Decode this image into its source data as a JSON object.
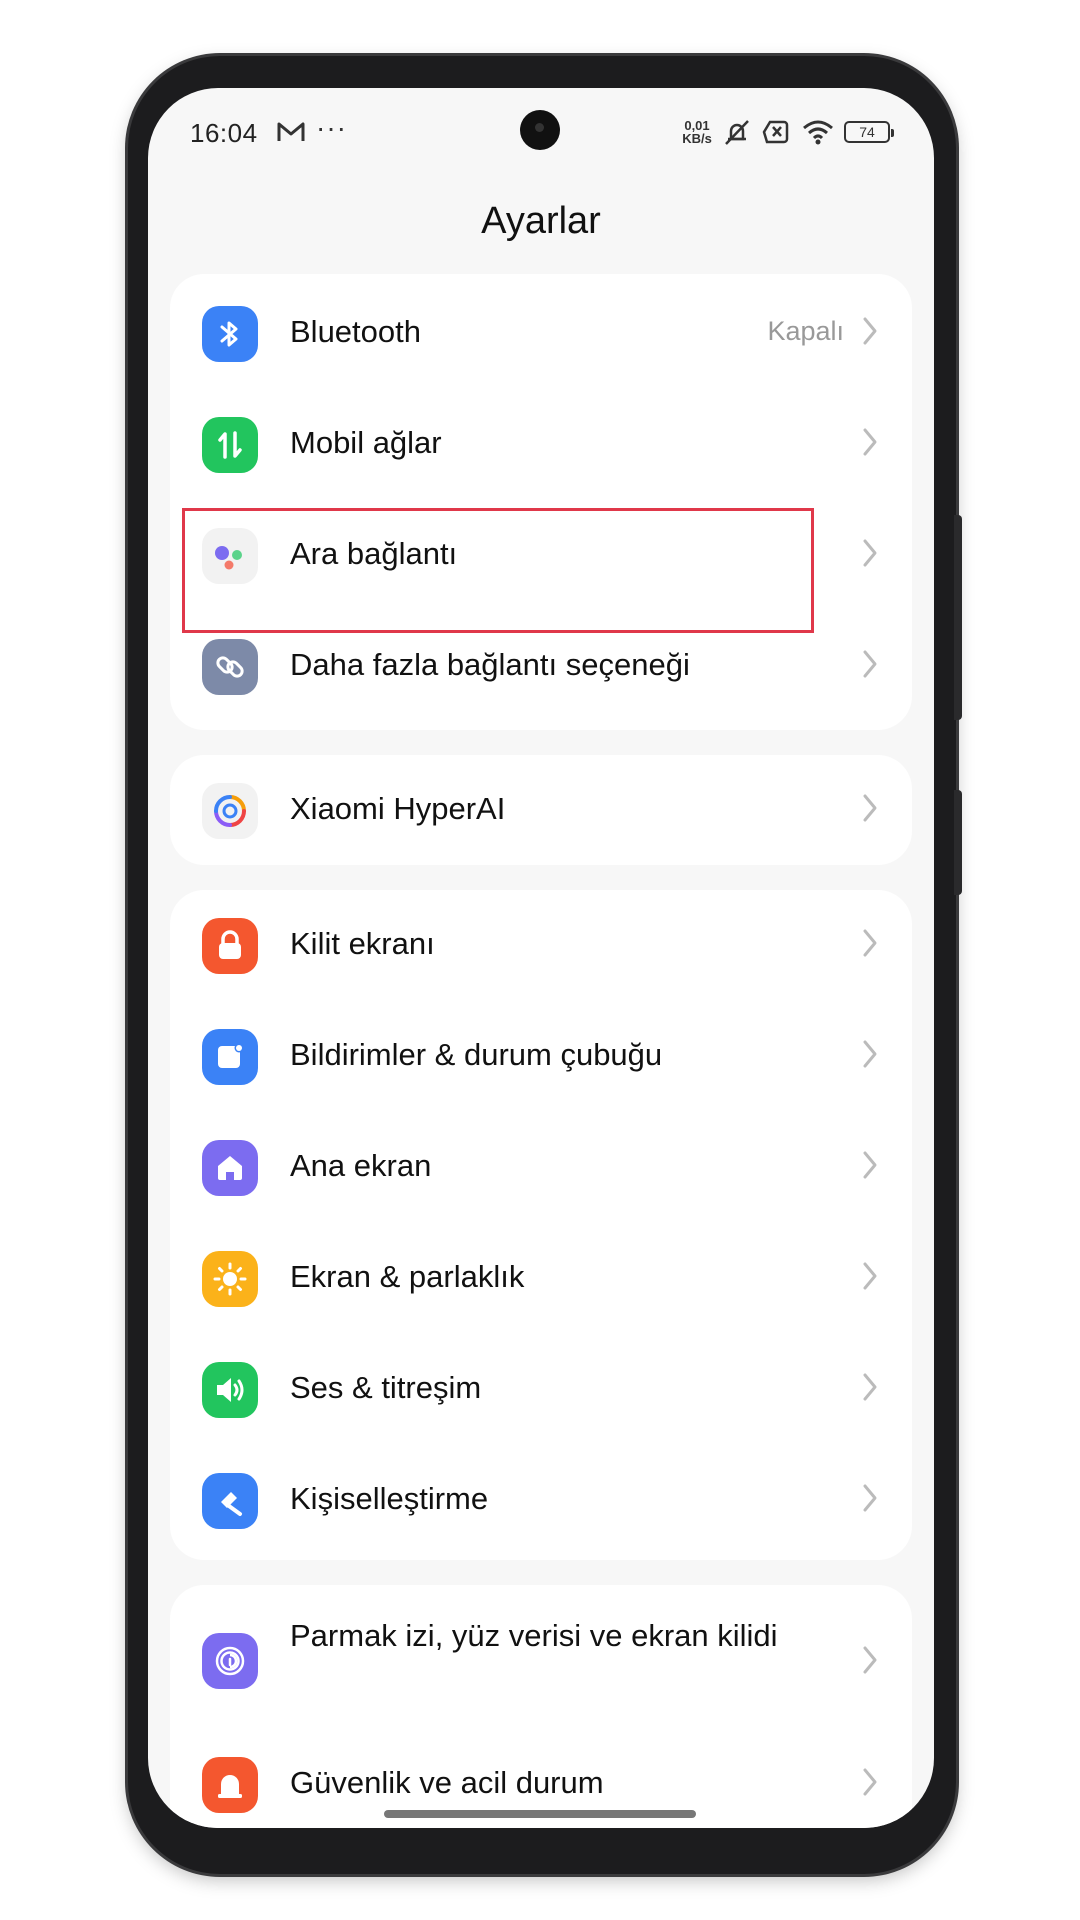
{
  "status": {
    "time": "16:04",
    "dots": "···",
    "speed_value": "0,01",
    "speed_unit": "KB/s",
    "battery": "74"
  },
  "header": {
    "title": "Ayarlar"
  },
  "groups": [
    {
      "items": [
        {
          "label": "Bluetooth",
          "value": "Kapalı",
          "icon": "bluetooth-icon",
          "color": "#3b82f6"
        },
        {
          "label": "Mobil ağlar",
          "icon": "mobile-data-icon",
          "color": "#22c55e"
        },
        {
          "label": "Ara bağlantı",
          "icon": "interconnect-icon",
          "color": "#f2f2f2"
        },
        {
          "label": "Daha fazla bağlantı seçeneği",
          "icon": "link-icon",
          "color": "#7d8aa8"
        }
      ]
    },
    {
      "items": [
        {
          "label": "Xiaomi HyperAI",
          "icon": "hyperai-icon",
          "color": "#f2f2f2"
        }
      ]
    },
    {
      "items": [
        {
          "label": "Kilit ekranı",
          "icon": "lock-icon",
          "color": "#f4572f"
        },
        {
          "label": "Bildirimler & durum çubuğu",
          "icon": "notification-icon",
          "color": "#3b82f6"
        },
        {
          "label": "Ana ekran",
          "icon": "home-icon",
          "color": "#7c6cf0"
        },
        {
          "label": "Ekran & parlaklık",
          "icon": "brightness-icon",
          "color": "#fbb21a"
        },
        {
          "label": "Ses & titreşim",
          "icon": "sound-icon",
          "color": "#22c55e"
        },
        {
          "label": "Kişiselleştirme",
          "icon": "personalization-icon",
          "color": "#3b82f6"
        }
      ]
    },
    {
      "items": [
        {
          "label": "Parmak izi, yüz verisi ve ekran kilidi",
          "icon": "fingerprint-icon",
          "color": "#7c6cf0"
        },
        {
          "label": "Güvenlik ve acil durum",
          "icon": "emergency-icon",
          "color": "#f4572f"
        }
      ]
    }
  ]
}
